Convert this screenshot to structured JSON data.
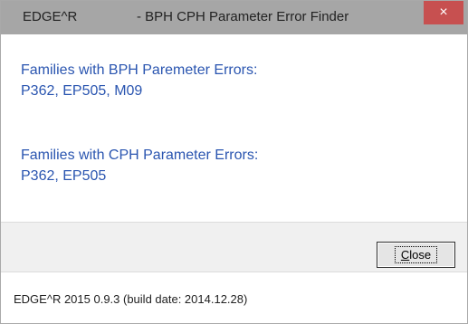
{
  "window": {
    "title_app": "EDGE^R",
    "title_name": "- BPH CPH Parameter Error Finder",
    "close_glyph": "×"
  },
  "bph": {
    "heading": "Families with BPH Paremeter Errors:",
    "families": "P362, EP505, M09"
  },
  "cph": {
    "heading": "Families with CPH Parameter Errors:",
    "families": "P362, EP505"
  },
  "actions": {
    "close_mnemonic": "C",
    "close_rest": "lose"
  },
  "status": {
    "text": "EDGE^R 2015 0.9.3 (build date: 2014.12.28)"
  },
  "colors": {
    "titlebar": "#a6a6a6",
    "close_button": "#c75050",
    "message_text": "#2a55b0"
  }
}
